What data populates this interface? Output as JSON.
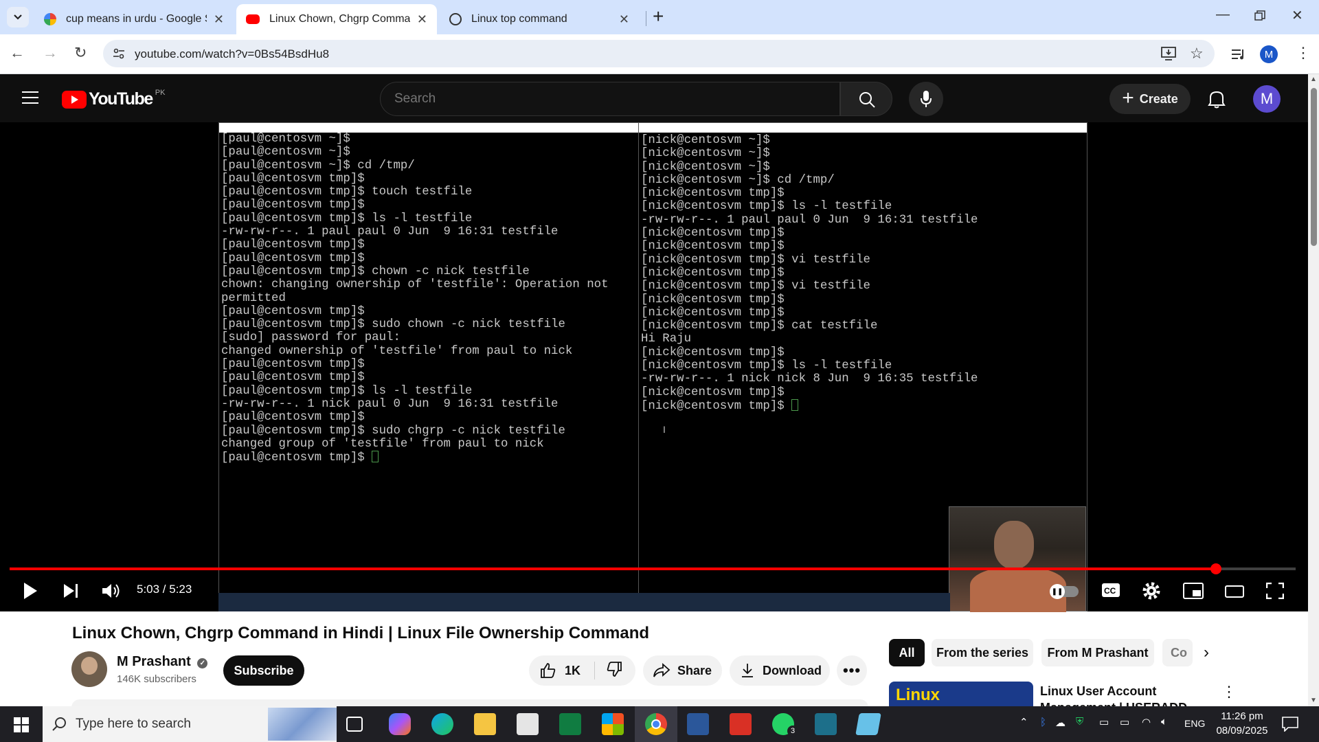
{
  "browser": {
    "tabs": [
      {
        "title": "cup means in urdu - Google Se",
        "active": false,
        "favicon": "google-icon"
      },
      {
        "title": "Linux Chown, Chgrp Command",
        "active": true,
        "favicon": "youtube-icon"
      },
      {
        "title": "Linux top command",
        "active": false,
        "favicon": "openai-icon"
      }
    ],
    "url": "youtube.com/watch?v=0Bs54BsdHu8",
    "profile_initial": "M"
  },
  "youtube": {
    "logo_text": "YouTube",
    "country_code": "PK",
    "search_placeholder": "Search",
    "create_label": "Create",
    "account_initial": "M"
  },
  "terminal_left": {
    "lines": [
      "[paul@centosvm ~]$",
      "[paul@centosvm ~]$",
      "[paul@centosvm ~]$ cd /tmp/",
      "[paul@centosvm tmp]$",
      "[paul@centosvm tmp]$ touch testfile",
      "[paul@centosvm tmp]$",
      "[paul@centosvm tmp]$ ls -l testfile",
      "-rw-rw-r--. 1 paul paul 0 Jun  9 16:31 testfile",
      "[paul@centosvm tmp]$",
      "[paul@centosvm tmp]$",
      "[paul@centosvm tmp]$ chown -c nick testfile",
      "chown: changing ownership of 'testfile': Operation not",
      "permitted",
      "[paul@centosvm tmp]$",
      "[paul@centosvm tmp]$ sudo chown -c nick testfile",
      "[sudo] password for paul:",
      "changed ownership of 'testfile' from paul to nick",
      "[paul@centosvm tmp]$",
      "[paul@centosvm tmp]$",
      "[paul@centosvm tmp]$ ls -l testfile",
      "-rw-rw-r--. 1 nick paul 0 Jun  9 16:31 testfile",
      "[paul@centosvm tmp]$",
      "[paul@centosvm tmp]$ sudo chgrp -c nick testfile",
      "changed group of 'testfile' from paul to nick"
    ],
    "prompt": "[paul@centosvm tmp]$ "
  },
  "terminal_right": {
    "lines": [
      "[nick@centosvm ~]$",
      "[nick@centosvm ~]$",
      "[nick@centosvm ~]$",
      "[nick@centosvm ~]$ cd /tmp/",
      "[nick@centosvm tmp]$",
      "[nick@centosvm tmp]$ ls -l testfile",
      "-rw-rw-r--. 1 paul paul 0 Jun  9 16:31 testfile",
      "[nick@centosvm tmp]$",
      "[nick@centosvm tmp]$",
      "[nick@centosvm tmp]$ vi testfile",
      "[nick@centosvm tmp]$",
      "[nick@centosvm tmp]$ vi testfile",
      "[nick@centosvm tmp]$",
      "[nick@centosvm tmp]$",
      "[nick@centosvm tmp]$ cat testfile",
      "Hi Raju",
      "[nick@centosvm tmp]$",
      "[nick@centosvm tmp]$ ls -l testfile",
      "-rw-rw-r--. 1 nick nick 8 Jun  9 16:35 testfile",
      "[nick@centosvm tmp]$"
    ],
    "prompt": "[nick@centosvm tmp]$ "
  },
  "player": {
    "time": "5:03 / 5:23",
    "progress_fraction": 0.938
  },
  "video": {
    "title": "Linux Chown, Chgrp Command in Hindi | Linux File Ownership Command",
    "channel": "M Prashant",
    "subscribers": "146K subscribers",
    "subscribe_label": "Subscribe",
    "likes": "1K",
    "share_label": "Share",
    "download_label": "Download"
  },
  "chips": [
    "All",
    "From the series",
    "From M Prashant",
    "Co"
  ],
  "recommendation": {
    "thumb_text": "Linux",
    "title_line1": "Linux User Account",
    "title_line2": "Management | USERADD"
  },
  "taskbar": {
    "search_placeholder": "Type here to search",
    "language": "ENG",
    "time": "11:26 pm",
    "date": "08/09/2025",
    "whatsapp_badge": "3"
  }
}
